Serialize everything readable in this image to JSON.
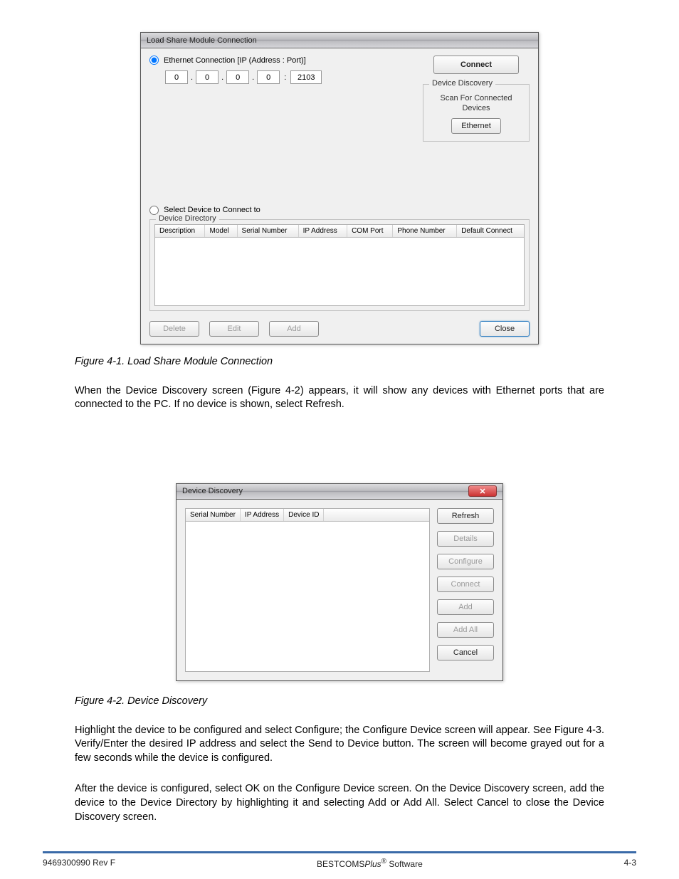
{
  "dialog1": {
    "title": "Load Share Module Connection",
    "radio_ethernet_label": "Ethernet Connection [IP (Address : Port)]",
    "ip": {
      "a": "0",
      "b": "0",
      "c": "0",
      "d": "0",
      "port": "2103"
    },
    "connect_button": "Connect",
    "discovery_group": "Device Discovery",
    "discovery_text": "Scan For Connected Devices",
    "ethernet_button": "Ethernet",
    "radio_select_label": "Select Device to Connect to",
    "directory_group": "Device Directory",
    "columns": [
      "Description",
      "Model",
      "Serial Number",
      "IP Address",
      "COM Port",
      "Phone Number",
      "Default Connect"
    ],
    "delete_button": "Delete",
    "edit_button": "Edit",
    "add_button": "Add",
    "close_button": "Close"
  },
  "figure1_caption": "Figure 4-1. Load Share Module Connection",
  "paragraph1": "When the Device Discovery screen (Figure 4-2) appears, it will show any devices with Ethernet ports that are connected to the PC. If no device is shown, select Refresh.",
  "dialog2": {
    "title": "Device Discovery",
    "columns": [
      "Serial Number",
      "IP Address",
      "Device ID"
    ],
    "refresh_button": "Refresh",
    "details_button": "Details",
    "configure_button": "Configure",
    "connect_button": "Connect",
    "add_button": "Add",
    "addall_button": "Add All",
    "cancel_button": "Cancel"
  },
  "figure2_caption": "Figure 4-2. Device Discovery",
  "paragraph2": "Highlight the device to be configured and select Configure; the Configure Device screen will appear. See Figure 4-3. Verify/Enter the desired IP address and select the Send to Device button. The screen will become grayed out for a few seconds while the device is configured.",
  "paragraph3": "After the device is configured, select OK on the Configure Device screen. On the Device Discovery screen, add the device to the Device Directory by highlighting it and selecting Add or Add All. Select Cancel to close the Device Discovery screen.",
  "footer": {
    "left": "9469300990 Rev F",
    "center_prefix": "BESTCOMS",
    "center_suffix": " Software",
    "center_italic": "Plus",
    "reg": "®",
    "right": "4-3"
  }
}
